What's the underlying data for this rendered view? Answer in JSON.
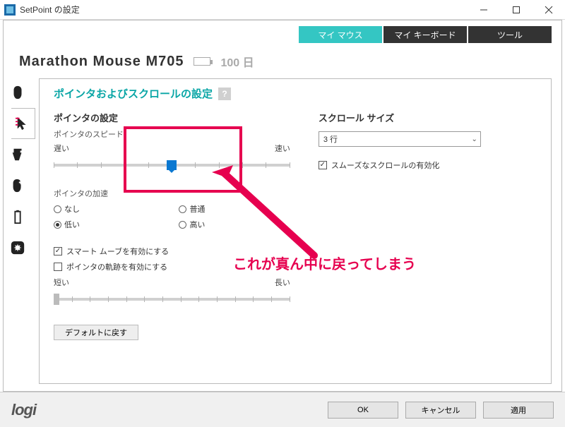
{
  "window": {
    "title": "SetPoint の設定"
  },
  "tabs": {
    "mouse": "マイ マウス",
    "keyboard": "マイ キーボード",
    "tools": "ツール"
  },
  "device": {
    "name": "Marathon Mouse M705",
    "battery_days": "100 日"
  },
  "section": {
    "title": "ポインタおよびスクロールの設定"
  },
  "pointer": {
    "heading": "ポインタの設定",
    "speed_label": "ポインタのスピード",
    "slow": "遅い",
    "fast": "速い",
    "accel_label": "ポインタの加速",
    "accel_none": "なし",
    "accel_normal": "普通",
    "accel_low": "低い",
    "accel_high": "高い",
    "smartmove": "スマート ムーブを有効にする",
    "trails_enable": "ポインタの軌跡を有効にする",
    "trails_short": "短い",
    "trails_long": "長い"
  },
  "scroll": {
    "heading": "スクロール サイズ",
    "combo_value": "3 行",
    "smooth": "スムーズなスクロールの有効化"
  },
  "buttons": {
    "defaults": "デフォルトに戻す",
    "ok": "OK",
    "cancel": "キャンセル",
    "apply": "適用"
  },
  "brand": "logi",
  "annotation": {
    "text": "これが真ん中に戻ってしまう"
  }
}
